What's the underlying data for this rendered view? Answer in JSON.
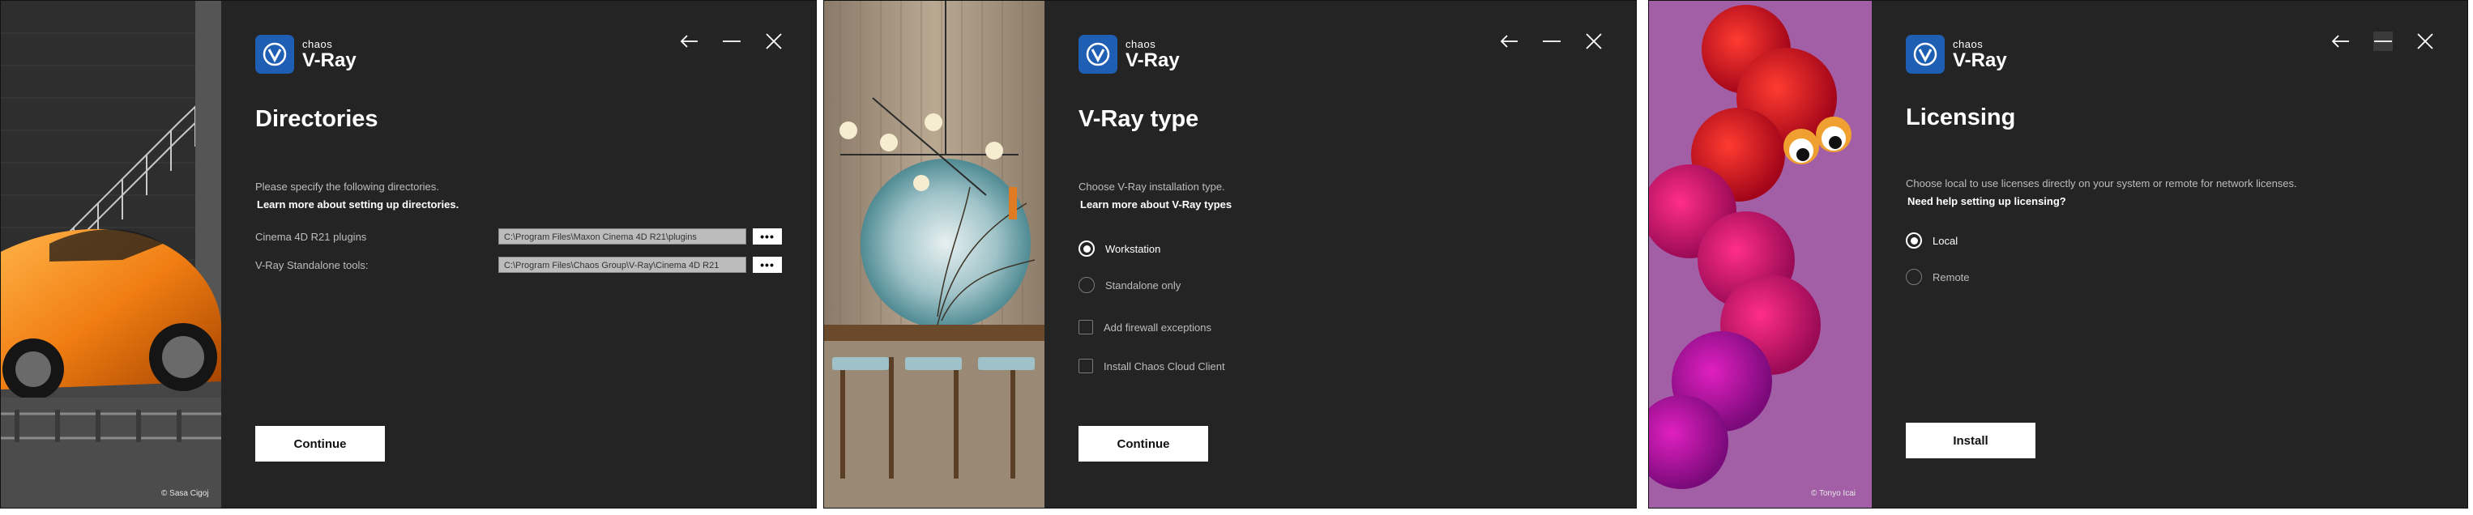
{
  "windows": [
    {
      "brand": "chaos",
      "product": "V-Ray",
      "title": "Directories",
      "description": "Please specify the following directories.",
      "learn_link": "Learn more about setting up directories.",
      "rows": [
        {
          "label": "Cinema 4D R21 plugins",
          "path": "C:\\Program Files\\Maxon Cinema 4D R21\\plugins",
          "browse": "•••"
        },
        {
          "label": "V-Ray Standalone tools:",
          "path": "C:\\Program Files\\Chaos Group\\V-Ray\\Cinema 4D R21",
          "browse": "•••"
        }
      ],
      "button": "Continue",
      "credit": "© Sasa Cigoj"
    },
    {
      "brand": "chaos",
      "product": "V-Ray",
      "title": "V-Ray type",
      "description": "Choose V-Ray installation type.",
      "learn_link": "Learn more about V-Ray types",
      "radios": [
        {
          "label": "Workstation",
          "selected": true
        },
        {
          "label": "Standalone only",
          "selected": false
        }
      ],
      "checks": [
        {
          "label": "Add firewall exceptions",
          "checked": false
        },
        {
          "label": "Install Chaos Cloud Client",
          "checked": false
        }
      ],
      "button": "Continue"
    },
    {
      "brand": "chaos",
      "product": "V-Ray",
      "title": "Licensing",
      "description": "Choose local to use licenses directly on your system or remote for network licenses.",
      "learn_link": "Need help setting up licensing?",
      "radios": [
        {
          "label": "Local",
          "selected": true
        },
        {
          "label": "Remote",
          "selected": false
        }
      ],
      "button": "Install",
      "credit": "© Tonyo Icai"
    }
  ],
  "colors": {
    "panel_bg": "#242424",
    "accent": "#1f5fb3",
    "text": "#bdbdbd"
  }
}
